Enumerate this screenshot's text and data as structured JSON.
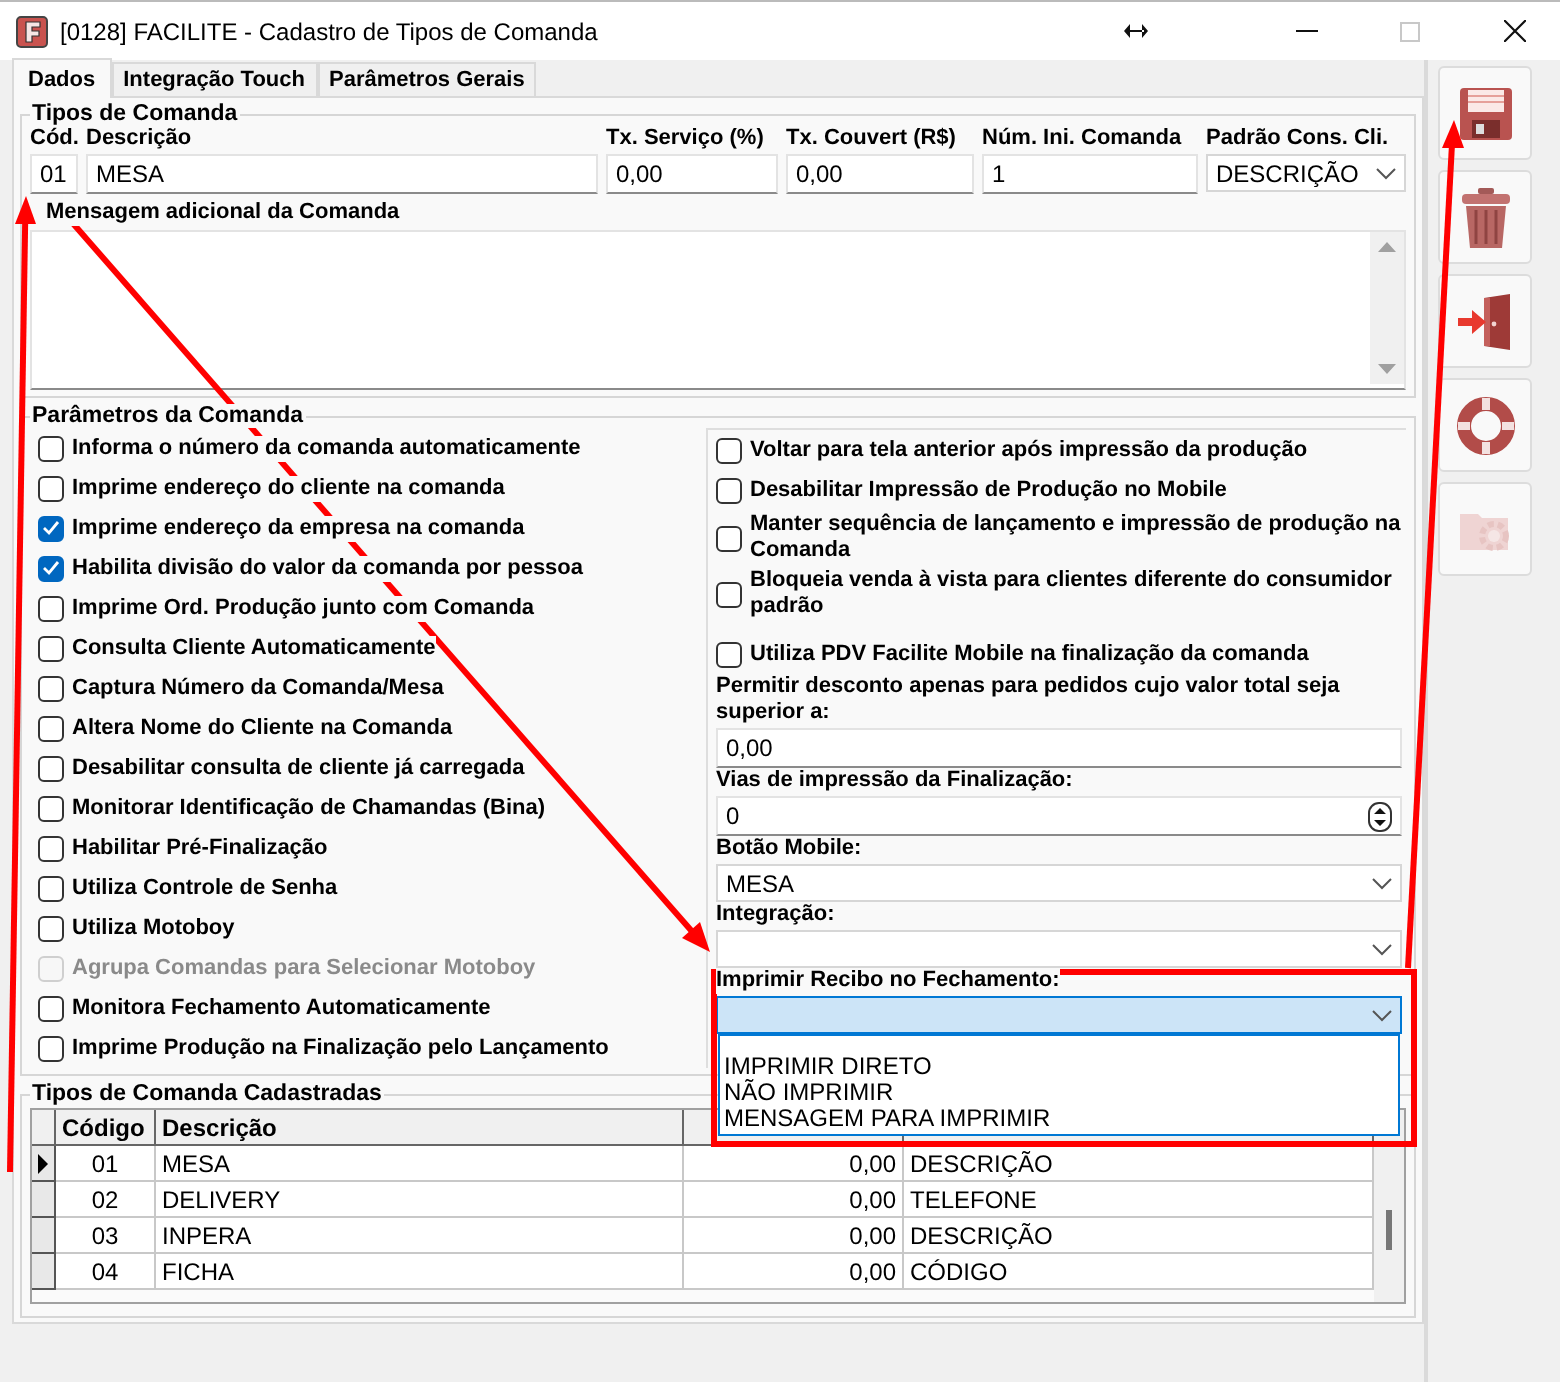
{
  "window": {
    "title": "[0128] FACILITE - Cadastro de Tipos de Comanda"
  },
  "tabs": [
    {
      "label": "Dados",
      "selected": true
    },
    {
      "label": "Integração Touch",
      "selected": false
    },
    {
      "label": "Parâmetros Gerais",
      "selected": false
    }
  ],
  "tipos_de_comanda": {
    "title": "Tipos de Comanda",
    "fields": [
      {
        "label": "Cód.",
        "value": "01",
        "kind": "text"
      },
      {
        "label": "Descrição",
        "value": "MESA",
        "kind": "text"
      },
      {
        "label": "Tx. Serviço (%)",
        "value": "0,00",
        "kind": "text"
      },
      {
        "label": "Tx. Couvert (R$)",
        "value": "0,00",
        "kind": "text"
      },
      {
        "label": "Núm. Ini. Comanda",
        "value": "1",
        "kind": "text"
      },
      {
        "label": "Padrão Cons. Cli.",
        "value": "DESCRIÇÃO",
        "kind": "combo"
      }
    ],
    "message_label": "Mensagem adicional da Comanda"
  },
  "parametros_da_comanda": {
    "title": "Parâmetros da Comanda",
    "left_options": [
      {
        "label": "Informa o número da comanda automaticamente",
        "checked": false,
        "disabled": false
      },
      {
        "label": "Imprime endereço do cliente na comanda",
        "checked": false,
        "disabled": false
      },
      {
        "label": "Imprime endereço da empresa na comanda",
        "checked": true,
        "disabled": false
      },
      {
        "label": "Habilita divisão do valor da comanda por pessoa",
        "checked": true,
        "disabled": false
      },
      {
        "label": "Imprime Ord. Produção junto com Comanda",
        "checked": false,
        "disabled": false
      },
      {
        "label": "Consulta Cliente Automaticamente",
        "checked": false,
        "disabled": false
      },
      {
        "label": "Captura Número da Comanda/Mesa",
        "checked": false,
        "disabled": false
      },
      {
        "label": "Altera Nome do Cliente na Comanda",
        "checked": false,
        "disabled": false
      },
      {
        "label": "Desabilitar consulta de cliente já carregada",
        "checked": false,
        "disabled": false
      },
      {
        "label": "Monitorar Identificação de Chamandas (Bina)",
        "checked": false,
        "disabled": false
      },
      {
        "label": "Habilitar Pré-Finalização",
        "checked": false,
        "disabled": false
      },
      {
        "label": "Utiliza Controle de Senha",
        "checked": false,
        "disabled": false
      },
      {
        "label": "Utiliza Motoboy",
        "checked": false,
        "disabled": false
      },
      {
        "label": "Agrupa Comandas para Selecionar Motoboy",
        "checked": false,
        "disabled": true
      },
      {
        "label": "Monitora Fechamento Automaticamente",
        "checked": false,
        "disabled": false
      },
      {
        "label": "Imprime Produção na Finalização pelo Lançamento",
        "checked": false,
        "disabled": false
      }
    ],
    "right_options": [
      {
        "label": "Voltar para tela anterior após impressão da produção",
        "checked": false
      },
      {
        "label": "Desabilitar Impressão de Produção no Mobile",
        "checked": false
      },
      {
        "label": "Manter sequência de lançamento e impressão de produção na Comanda",
        "checked": false
      },
      {
        "label": "Bloqueia venda à vista para clientes diferente do consumidor padrão",
        "checked": false
      },
      {
        "label": "Utiliza PDV Facilite Mobile na finalização da comanda",
        "checked": false
      }
    ],
    "fields": [
      {
        "label": "Permitir desconto apenas para pedidos cujo valor total seja superior a:",
        "value": "0,00",
        "kind": "text"
      },
      {
        "label": "Vias de impressão da Finalização:",
        "value": "0",
        "kind": "spin"
      },
      {
        "label": "Botão Mobile:",
        "value": "MESA",
        "kind": "combo",
        "focused": false,
        "expanded": false
      },
      {
        "label": "Integração:",
        "kind": "combo",
        "focused": false,
        "expanded": false
      },
      {
        "label": "Imprimir Recibo no Fechamento:",
        "kind": "combo",
        "focused": true,
        "expanded": true,
        "options": [
          "IMPRIMIR DIRETO",
          "NÃO IMPRIMIR",
          "MENSAGEM PARA IMPRIMIR"
        ]
      }
    ]
  },
  "grid": {
    "title": "Tipos de Comanda Cadastradas",
    "columns": [
      "Código",
      "Descrição"
    ],
    "rows": [
      {
        "code": "01",
        "description": "MESA",
        "column_3": "0,00",
        "column_4": "DESCRIÇÃO",
        "selected": true
      },
      {
        "code": "02",
        "description": "DELIVERY",
        "column_3": "0,00",
        "column_4": "TELEFONE",
        "selected": false
      },
      {
        "code": "03",
        "description": "INPERA",
        "column_3": "0,00",
        "column_4": "DESCRIÇÃO",
        "selected": false
      },
      {
        "code": "04",
        "description": "FICHA",
        "column_3": "0,00",
        "column_4": "CÓDIGO",
        "selected": false
      }
    ]
  },
  "toolbar": [
    {
      "kind": "save",
      "disabled": false
    },
    {
      "kind": "delete",
      "disabled": false
    },
    {
      "kind": "exit",
      "disabled": false
    },
    {
      "kind": "help",
      "disabled": false
    },
    {
      "kind": "settings",
      "disabled": true
    }
  ]
}
